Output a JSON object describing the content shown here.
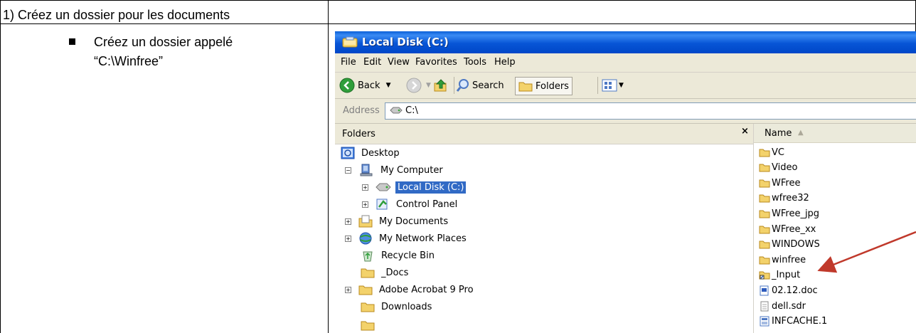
{
  "document": {
    "step_title": "1) Créez un dossier pour les documents",
    "instruction_line1": "Créez un dossier appelé",
    "instruction_line2": "“C:\\Winfree”"
  },
  "window": {
    "title": "Local Disk (C:)",
    "menu": [
      "File",
      "Edit",
      "View",
      "Favorites",
      "Tools",
      "Help"
    ],
    "toolbar": {
      "back_label": "Back",
      "search_label": "Search",
      "folders_label": "Folders"
    },
    "address": {
      "label": "Address",
      "value": "C:\\"
    },
    "folders_pane": {
      "title": "Folders",
      "close_glyph": "×",
      "tree": [
        {
          "label": "Desktop",
          "icon": "desktop-icon",
          "expander": ""
        },
        {
          "label": "My Computer",
          "icon": "computer-icon",
          "expander": "−"
        },
        {
          "label": "Local Disk (C:)",
          "icon": "drive-icon",
          "expander": "+",
          "selected": true
        },
        {
          "label": "Control Panel",
          "icon": "control-panel-icon",
          "expander": "+"
        },
        {
          "label": "My Documents",
          "icon": "documents-icon",
          "expander": "+"
        },
        {
          "label": "My Network Places",
          "icon": "network-icon",
          "expander": "+"
        },
        {
          "label": "Recycle Bin",
          "icon": "recycle-bin-icon",
          "expander": ""
        },
        {
          "label": "_Docs",
          "icon": "folder-icon",
          "expander": ""
        },
        {
          "label": "Adobe Acrobat 9 Pro",
          "icon": "folder-icon",
          "expander": "+"
        },
        {
          "label": "Downloads",
          "icon": "folder-icon",
          "expander": ""
        }
      ]
    },
    "file_list": {
      "column_name": "Name",
      "sort_glyph": "▲",
      "items": [
        {
          "name": "VC",
          "icon": "folder-icon"
        },
        {
          "name": "Video",
          "icon": "folder-icon"
        },
        {
          "name": "WFree",
          "icon": "folder-icon"
        },
        {
          "name": "wfree32",
          "icon": "folder-icon"
        },
        {
          "name": "WFree_jpg",
          "icon": "folder-icon"
        },
        {
          "name": "WFree_xx",
          "icon": "folder-icon"
        },
        {
          "name": "WINDOWS",
          "icon": "folder-icon"
        },
        {
          "name": "winfree",
          "icon": "folder-icon"
        },
        {
          "name": "_Input",
          "icon": "shortcut-folder-icon"
        },
        {
          "name": "02.12.doc",
          "icon": "word-document-icon"
        },
        {
          "name": "dell.sdr",
          "icon": "file-icon"
        },
        {
          "name": "INFCACHE.1",
          "icon": "system-file-icon"
        }
      ]
    }
  },
  "colors": {
    "titlebar": "#0755d6",
    "selection": "#316ac5",
    "arrow": "#c0392b",
    "folder": "#f3d26b"
  }
}
